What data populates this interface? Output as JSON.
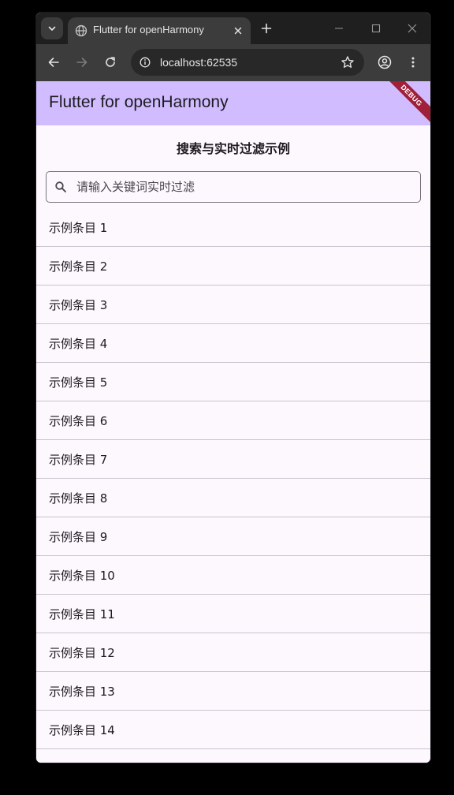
{
  "browser": {
    "tab_title": "Flutter for openHarmony",
    "url": "localhost:62535"
  },
  "app": {
    "title": "Flutter for openHarmony",
    "debug_label": "DEBUG",
    "accent_color": "#d0bcff",
    "background_color": "#fdf7fe"
  },
  "page": {
    "heading": "搜索与实时过滤示例",
    "search_placeholder": "请输入关键词实时过滤",
    "search_value": ""
  },
  "items": [
    "示例条目 1",
    "示例条目 2",
    "示例条目 3",
    "示例条目 4",
    "示例条目 5",
    "示例条目 6",
    "示例条目 7",
    "示例条目 8",
    "示例条目 9",
    "示例条目 10",
    "示例条目 11",
    "示例条目 12",
    "示例条目 13",
    "示例条目 14"
  ],
  "icons": {
    "tab_search": "chevron-down-icon",
    "favicon": "globe-icon",
    "tab_close": "close-icon",
    "new_tab": "plus-icon",
    "minimize": "minimize-icon",
    "maximize": "maximize-icon",
    "close_window": "close-icon",
    "back": "back-arrow-icon",
    "forward": "forward-arrow-icon",
    "reload": "reload-icon",
    "site_info": "info-icon",
    "bookmark": "star-icon",
    "profile": "profile-icon",
    "menu": "more-vert-icon",
    "search": "search-icon"
  }
}
